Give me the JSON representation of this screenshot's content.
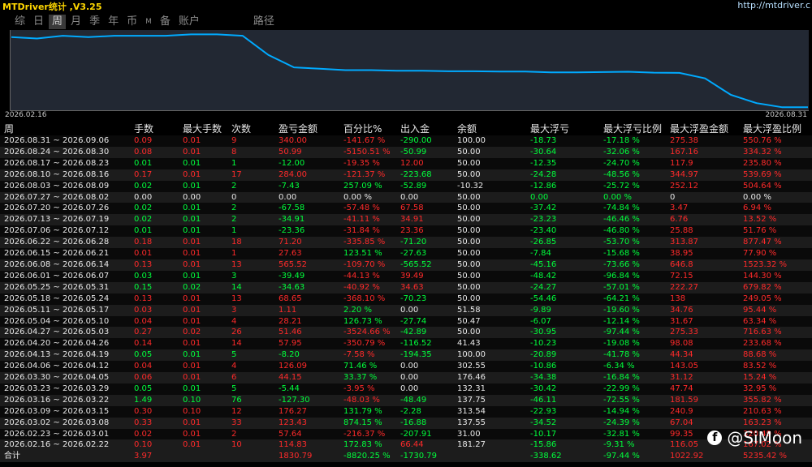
{
  "app_title": "MTDriver统计 ,V3.25",
  "url": "http://mtdriver.c",
  "tabs": [
    "综",
    "日",
    "周",
    "月",
    "季",
    "年",
    "币",
    "M",
    "备",
    "账户",
    "路径"
  ],
  "active_tab": "周",
  "chart_data": {
    "type": "line",
    "x_start_label": "2026.02.16",
    "x_end_label": "2026.08.31",
    "color": "#00aaff",
    "values": [
      50,
      49.5,
      50.5,
      50,
      50.5,
      50.5,
      50.5,
      51,
      51,
      50.5,
      43.5,
      39,
      38.5,
      38,
      38,
      37.8,
      37.8,
      37.6,
      37.6,
      37.5,
      37.5,
      37.2,
      37.2,
      37.3,
      37.4,
      37.1,
      37,
      35,
      29,
      26,
      24.5,
      24.5
    ],
    "ylim": [
      24,
      52
    ]
  },
  "columns": [
    "周",
    "手数",
    "最大手数",
    "次数",
    "盈亏金额",
    "百分比%",
    "出入金",
    "余额",
    "最大浮亏",
    "最大浮亏比例",
    "最大浮盈金额",
    "最大浮盈比例"
  ],
  "rows": [
    [
      "2026.08.31 ~ 2026.09.06",
      "0.09",
      "0.01",
      "9",
      "340.00",
      "-141.67 %",
      "-290.00",
      "100.00",
      "-18.73",
      "-17.18 %",
      "275.38",
      "550.76 %"
    ],
    [
      "2026.08.24 ~ 2026.08.30",
      "0.08",
      "0.01",
      "8",
      "50.99",
      "-5150.51 %",
      "-50.99",
      "50.00",
      "-30.64",
      "-32.06 %",
      "167.16",
      "334.32 %"
    ],
    [
      "2026.08.17 ~ 2026.08.23",
      "0.01",
      "0.01",
      "1",
      "-12.00",
      "-19.35 %",
      "12.00",
      "50.00",
      "-12.35",
      "-24.70 %",
      "117.9",
      "235.80 %"
    ],
    [
      "2026.08.10 ~ 2026.08.16",
      "0.17",
      "0.01",
      "17",
      "284.00",
      "-121.37 %",
      "-223.68",
      "50.00",
      "-24.28",
      "-48.56 %",
      "344.97",
      "539.69 %"
    ],
    [
      "2026.08.03 ~ 2026.08.09",
      "0.02",
      "0.01",
      "2",
      "-7.43",
      "257.09 %",
      "-52.89",
      "-10.32",
      "-12.86",
      "-25.72 %",
      "252.12",
      "504.64 %"
    ],
    [
      "2026.07.27 ~ 2026.08.02",
      "0.00",
      "0.00",
      "0",
      "0.00",
      "0.00 %",
      "0.00",
      "50.00",
      "0.00",
      "0.00 %",
      "0",
      "0.00 %"
    ],
    [
      "2026.07.20 ~ 2026.07.26",
      "0.02",
      "0.01",
      "2",
      "-67.58",
      "-57.48 %",
      "67.58",
      "50.00",
      "-37.42",
      "-74.84 %",
      "3.47",
      "6.94 %"
    ],
    [
      "2026.07.13 ~ 2026.07.19",
      "0.02",
      "0.01",
      "2",
      "-34.91",
      "-41.11 %",
      "34.91",
      "50.00",
      "-23.23",
      "-46.46 %",
      "6.76",
      "13.52 %"
    ],
    [
      "2026.07.06 ~ 2026.07.12",
      "0.01",
      "0.01",
      "1",
      "-23.36",
      "-31.84 %",
      "23.36",
      "50.00",
      "-23.40",
      "-46.80 %",
      "25.88",
      "51.76 %"
    ],
    [
      "2026.06.22 ~ 2026.06.28",
      "0.18",
      "0.01",
      "18",
      "71.20",
      "-335.85 %",
      "-71.20",
      "50.00",
      "-26.85",
      "-53.70 %",
      "313.87",
      "877.47 %"
    ],
    [
      "2026.06.15 ~ 2026.06.21",
      "0.01",
      "0.01",
      "1",
      "27.63",
      "123.51 %",
      "-27.63",
      "50.00",
      "-7.84",
      "-15.68 %",
      "38.95",
      "77.90 %"
    ],
    [
      "2026.06.08 ~ 2026.06.14",
      "0.13",
      "0.01",
      "13",
      "565.52",
      "-109.70 %",
      "-565.52",
      "50.00",
      "-45.16",
      "-73.66 %",
      "646.8",
      "1523.32 %"
    ],
    [
      "2026.06.01 ~ 2026.06.07",
      "0.03",
      "0.01",
      "3",
      "-39.49",
      "-44.13 %",
      "39.49",
      "50.00",
      "-48.42",
      "-96.84 %",
      "72.15",
      "144.30 %"
    ],
    [
      "2026.05.25 ~ 2026.05.31",
      "0.15",
      "0.02",
      "14",
      "-34.63",
      "-40.92 %",
      "34.63",
      "50.00",
      "-24.27",
      "-57.01 %",
      "222.27",
      "679.82 %"
    ],
    [
      "2026.05.18 ~ 2026.05.24",
      "0.13",
      "0.01",
      "13",
      "68.65",
      "-368.10 %",
      "-70.23",
      "50.00",
      "-54.46",
      "-64.21 %",
      "138",
      "249.05 %"
    ],
    [
      "2026.05.11 ~ 2026.05.17",
      "0.03",
      "0.01",
      "3",
      "1.11",
      "2.20 %",
      "0.00",
      "51.58",
      "-9.89",
      "-19.60 %",
      "34.76",
      "95.44 %"
    ],
    [
      "2026.05.04 ~ 2026.05.10",
      "0.04",
      "0.01",
      "4",
      "28.21",
      "126.73 %",
      "-27.74",
      "50.47",
      "-6.07",
      "-12.14 %",
      "31.67",
      "63.34 %"
    ],
    [
      "2026.04.27 ~ 2026.05.03",
      "0.27",
      "0.02",
      "26",
      "51.46",
      "-3524.66 %",
      "-42.89",
      "50.00",
      "-30.95",
      "-97.44 %",
      "275.33",
      "716.63 %"
    ],
    [
      "2026.04.20 ~ 2026.04.26",
      "0.14",
      "0.01",
      "14",
      "57.95",
      "-350.79 %",
      "-116.52",
      "41.43",
      "-10.23",
      "-19.08 %",
      "98.08",
      "233.68 %"
    ],
    [
      "2026.04.13 ~ 2026.04.19",
      "0.05",
      "0.01",
      "5",
      "-8.20",
      "-7.58 %",
      "-194.35",
      "100.00",
      "-20.89",
      "-41.78 %",
      "44.34",
      "88.68 %"
    ],
    [
      "2026.04.06 ~ 2026.04.12",
      "0.04",
      "0.01",
      "4",
      "126.09",
      "71.46 %",
      "0.00",
      "302.55",
      "-10.86",
      "-6.34 %",
      "143.05",
      "83.52 %"
    ],
    [
      "2026.03.30 ~ 2026.04.05",
      "0.06",
      "0.01",
      "6",
      "44.15",
      "33.37 %",
      "0.00",
      "176.46",
      "-34.38",
      "-16.84 %",
      "31.12",
      "15.24 %"
    ],
    [
      "2026.03.23 ~ 2026.03.29",
      "0.05",
      "0.01",
      "5",
      "-5.44",
      "-3.95 %",
      "0.00",
      "132.31",
      "-30.42",
      "-22.99 %",
      "47.74",
      "32.95 %"
    ],
    [
      "2026.03.16 ~ 2026.03.22",
      "1.49",
      "0.10",
      "76",
      "-127.30",
      "-48.03 %",
      "-48.49",
      "137.75",
      "-46.11",
      "-72.55 %",
      "181.59",
      "355.82 %"
    ],
    [
      "2026.03.09 ~ 2026.03.15",
      "0.30",
      "0.10",
      "12",
      "176.27",
      "131.79 %",
      "-2.28",
      "313.54",
      "-22.93",
      "-14.94 %",
      "240.9",
      "210.63 %"
    ],
    [
      "2026.03.02 ~ 2026.03.08",
      "0.33",
      "0.01",
      "33",
      "123.43",
      "874.15 %",
      "-16.88",
      "137.55",
      "-34.52",
      "-24.39 %",
      "67.04",
      "163.23 %"
    ],
    [
      "2026.02.23 ~ 2026.03.01",
      "0.02",
      "0.01",
      "2",
      "57.64",
      "-216.37 %",
      "-207.91",
      "31.00",
      "-10.17",
      "-32.81 %",
      "99.35",
      "320.49 %"
    ],
    [
      "2026.02.16 ~ 2026.02.22",
      "0.10",
      "0.01",
      "10",
      "114.83",
      "172.83 %",
      "66.44",
      "181.27",
      "-15.86",
      "-9.31 %",
      "116.05",
      "167.02 %"
    ]
  ],
  "total": [
    "合计",
    "3.97",
    "",
    "",
    "1830.79",
    "-8820.25 %",
    "-1730.79",
    "",
    "-338.62",
    "-97.44 %",
    "1022.92",
    "5235.42 %"
  ],
  "watermark": "@SiMoon",
  "watermark_icon": "facebook-icon"
}
